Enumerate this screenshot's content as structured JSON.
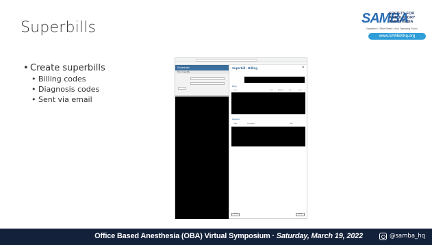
{
  "slide": {
    "title": "Superbills",
    "bullets": {
      "main": "Create superbills",
      "sub": [
        "Billing codes",
        "Diagnosis codes",
        "Sent via email"
      ]
    }
  },
  "logo": {
    "samba": "SAMBA",
    "society": "SOCIETY FOR AMBULATORY ANESTHESIA",
    "tagline": "Outpatient • Office Based • Non Operating Room",
    "url": "www.SAMBAhq.org"
  },
  "screenshot": {
    "app_header": "Scheduler",
    "app_tabs": "Home   Superbills",
    "panel_title": "Superbill - Billing",
    "close_icon": "×",
    "section_billing": "Billing",
    "section_diagnosis": "Diagnosis",
    "billing_headers": [
      "Code",
      "Units",
      "Modifier",
      "Price",
      "Total"
    ],
    "diagnosis_headers": [
      "Code",
      "Description",
      "Ref"
    ],
    "btn_cancel": "Cancel",
    "btn_send": "Send"
  },
  "footer": {
    "text_main": "Office Based Anesthesia (OBA) Virtual Symposium · ",
    "text_date": "Saturday, March 19, 2022",
    "instagram_handle": "@samba_hq"
  },
  "colors": {
    "footer_bg": "#13213a",
    "brand_blue": "#2a6db3",
    "logo_url_bg": "#2f9ed8"
  }
}
